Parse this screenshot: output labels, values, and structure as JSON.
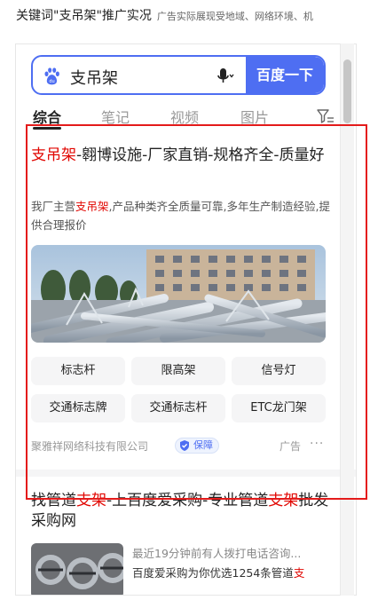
{
  "caption": {
    "main": "关键词\"支吊架\"推广实况",
    "sub": "广告实际展现受地域、网络环境、机"
  },
  "search": {
    "query": "支吊架",
    "button_label": "百度一下"
  },
  "tabs": [
    {
      "label": "综合",
      "active": true
    },
    {
      "label": "笔记",
      "active": false
    },
    {
      "label": "视频",
      "active": false
    },
    {
      "label": "图片",
      "active": false
    }
  ],
  "ad": {
    "title_highlight": "支吊架",
    "title_rest": "-翱博设施-厂家直销-规格齐全-质量好",
    "desc_prefix": "我厂主营",
    "desc_highlight": "支吊架",
    "desc_rest": ",产品种类齐全质量可靠,多年生产制造经验,提供合理报价",
    "chips": [
      "标志杆",
      "限高架",
      "信号灯",
      "交通标志牌",
      "交通标志杆",
      "ETC龙门架"
    ],
    "company": "聚雅祥网络科技有限公司",
    "badge": "保障",
    "ad_label": "广告",
    "more": "···"
  },
  "result2": {
    "title_parts": [
      {
        "text": "找管道",
        "hl": false
      },
      {
        "text": "支架",
        "hl": true
      },
      {
        "text": "-上百度爱采购-专业管道",
        "hl": false
      },
      {
        "text": "支架",
        "hl": true
      },
      {
        "text": "批发采购网",
        "hl": false
      }
    ],
    "line1": "最近19分钟前有人拨打电话咨询...",
    "line2_prefix": "百度爱采购为你优选1254条管道",
    "line2_highlight": "支"
  },
  "colors": {
    "brand_blue": "#4e6ef2",
    "highlight_red": "#e10601",
    "annotation_box": "#e41b1b"
  }
}
